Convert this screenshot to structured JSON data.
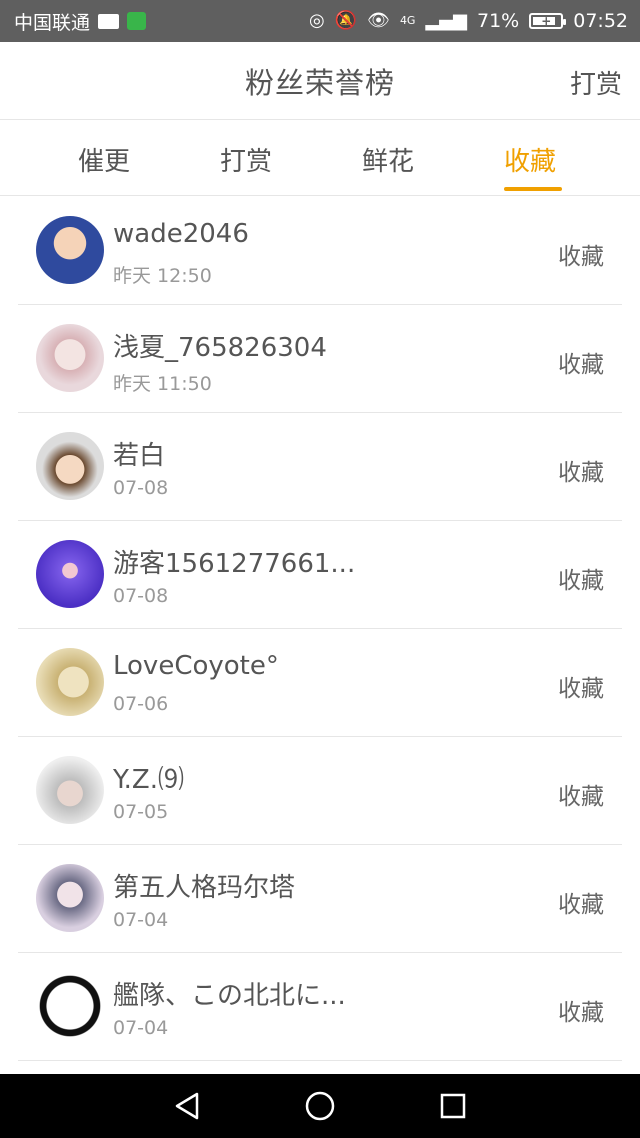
{
  "status_bar": {
    "carrier": "中国联通",
    "signal": "4G",
    "battery": "71%",
    "time": "07:52"
  },
  "header": {
    "title": "粉丝荣誉榜",
    "right_action": "打赏"
  },
  "tabs": [
    {
      "label": "催更"
    },
    {
      "label": "打赏"
    },
    {
      "label": "鲜花"
    },
    {
      "label": "收藏",
      "active": true
    }
  ],
  "list": [
    {
      "name": "wade2046",
      "time": "昨天 12:50",
      "action": "收藏",
      "avatar_color": "#2f4a9e"
    },
    {
      "name": "浅夏_765826304",
      "time": "昨天 11:50",
      "action": "收藏",
      "avatar_color": "#e9d8dc"
    },
    {
      "name": "若白",
      "time": "07-08",
      "action": "收藏",
      "avatar_color": "#8a6a4c"
    },
    {
      "name": "游客1561277661...",
      "time": "07-08",
      "action": "收藏",
      "avatar_color": "#5b3fd1"
    },
    {
      "name": "LoveCoyote°",
      "time": "07-06",
      "action": "收藏",
      "avatar_color": "#d9c694"
    },
    {
      "name": "Y.Z.⑼",
      "time": "07-05",
      "action": "收藏",
      "avatar_color": "#9d9d9d"
    },
    {
      "name": "第五人格玛尔塔",
      "time": "07-04",
      "action": "收藏",
      "avatar_color": "#c7b9cc"
    },
    {
      "name": "艦隊、この北北に...",
      "time": "07-04",
      "action": "收藏",
      "avatar_color": "#1a1a1a"
    }
  ],
  "colors": {
    "accent": "#f0a000",
    "statusbar": "#5f5f5f",
    "navbar": "#000000"
  },
  "nav": {
    "back_icon": "back-triangle-icon",
    "home_icon": "home-circle-icon",
    "recents_icon": "recents-square-icon"
  }
}
